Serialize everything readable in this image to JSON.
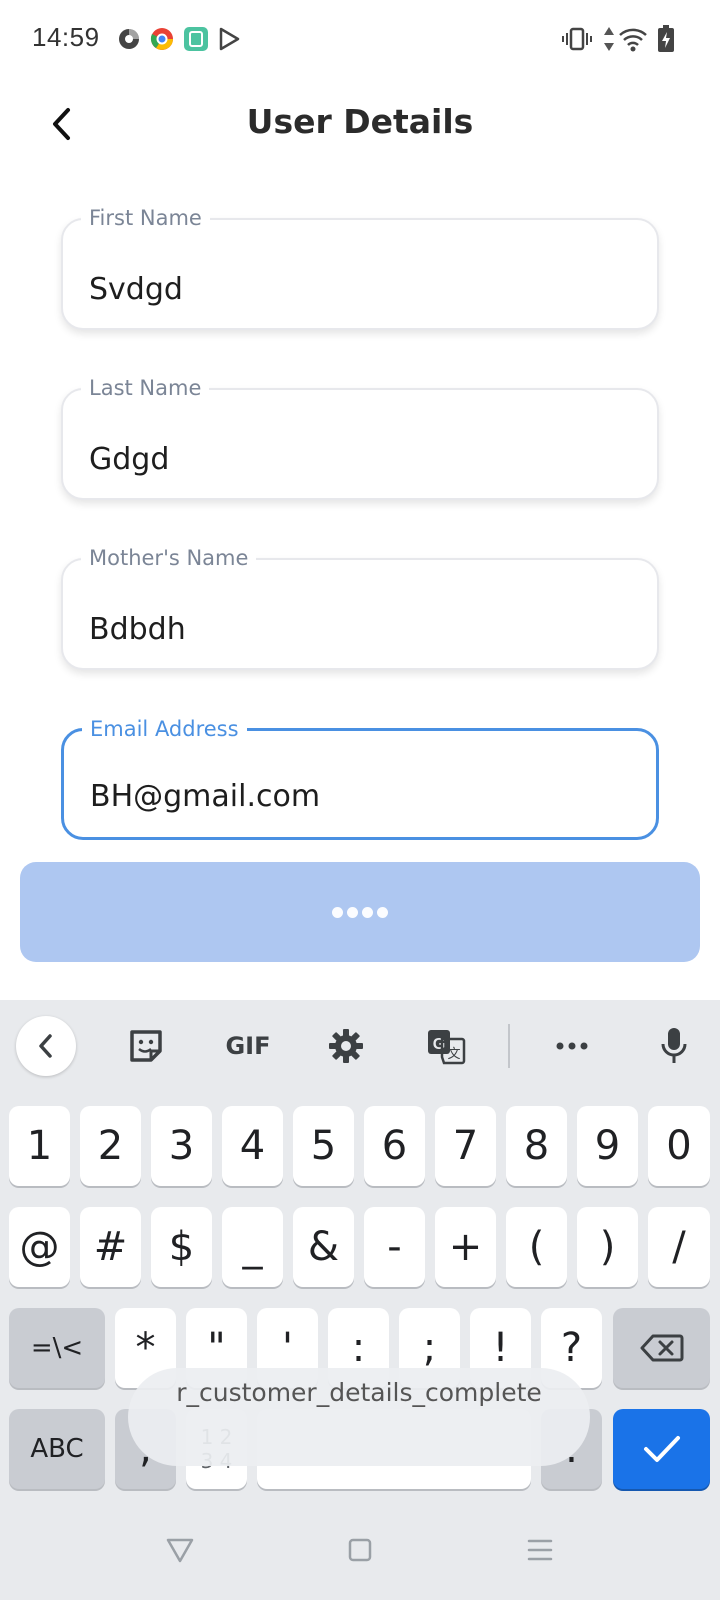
{
  "status_bar": {
    "time": "14:59",
    "notification_icons": [
      "color-circle-icon",
      "chrome-like-icon",
      "green-app-icon",
      "play-store-icon"
    ],
    "system_icons": [
      "vibrate-icon",
      "data-arrows-icon",
      "wifi-icon",
      "battery-charging-icon"
    ]
  },
  "header": {
    "title": "User Details",
    "back_icon": "chevron-left-icon"
  },
  "form": {
    "fields": [
      {
        "label": "First Name",
        "value": "Svdgd",
        "active": false
      },
      {
        "label": "Last Name",
        "value": "Gdgd",
        "active": false
      },
      {
        "label": "Mother's Name",
        "value": "Bdbdh",
        "active": false
      },
      {
        "label": "Email Address",
        "value": "BH@gmail.com",
        "active": true
      }
    ],
    "accent_color": "#4a90e2"
  },
  "submit": {
    "state": "loading",
    "color": "#aec7f1"
  },
  "keyboard": {
    "toolbar": [
      "back-icon",
      "sticker-icon",
      "gif-icon",
      "settings-icon",
      "translate-icon",
      "more-icon",
      "microphone-icon"
    ],
    "gif_label": "GIF",
    "row1": [
      "1",
      "2",
      "3",
      "4",
      "5",
      "6",
      "7",
      "8",
      "9",
      "0"
    ],
    "row2": [
      "@",
      "#",
      "$",
      "_",
      "&",
      "-",
      "+",
      "(",
      ")",
      "/"
    ],
    "row3": [
      "=\\<",
      "*",
      "\"",
      "'",
      ":",
      ";",
      "!",
      "?"
    ],
    "row4": {
      "abc": "ABC",
      "comma": ",",
      "numpad_top": "1 2",
      "numpad_bottom": "3 4",
      "period": "."
    },
    "suggestion": "r_customer_details_complete",
    "action_color": "#1a73e8"
  },
  "navbar": [
    "back-triangle-icon",
    "home-square-icon",
    "recents-menu-icon"
  ]
}
